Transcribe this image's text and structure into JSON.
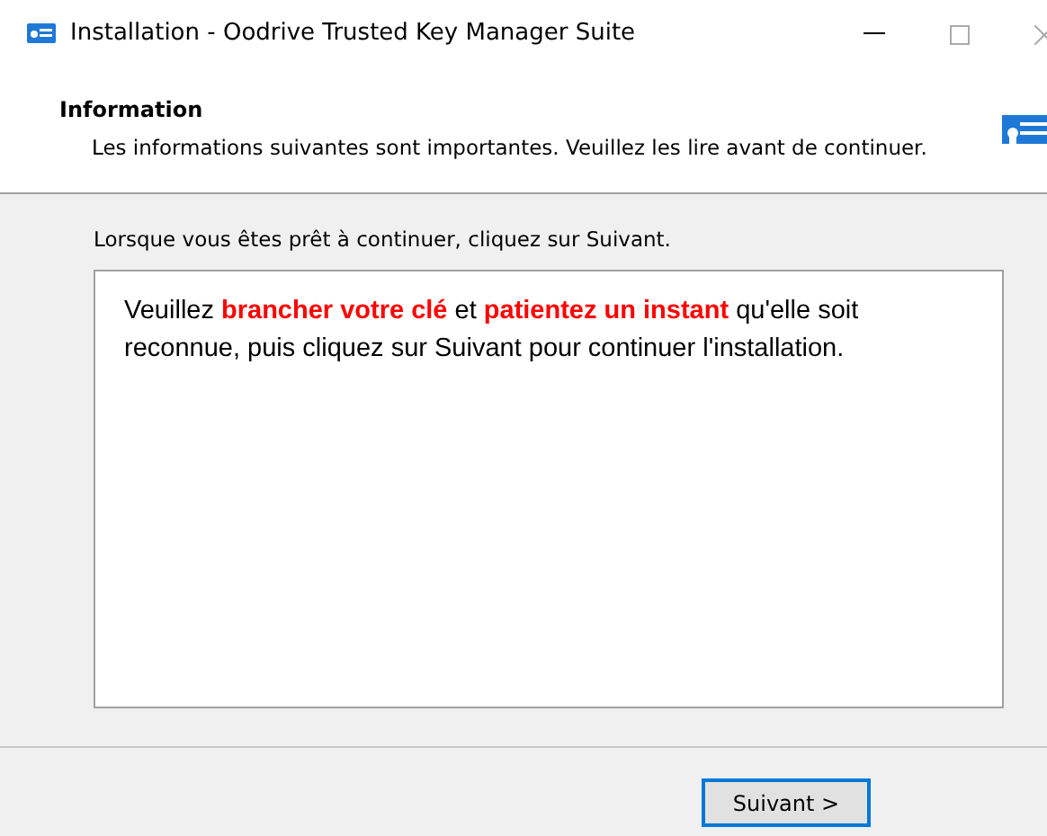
{
  "window": {
    "title": "Installation - Oodrive Trusted Key Manager Suite"
  },
  "header": {
    "title": "Information",
    "subtitle": "Les informations suivantes sont importantes. Veuillez les lire avant de continuer."
  },
  "body": {
    "instruction": "Lorsque vous êtes prêt à continuer, cliquez sur Suivant.",
    "memo": "Veuillez **brancher votre clé** et **patientez un instant** qu'elle soit reconnue, puis cliquez sur Suivant pour continuer l'installation."
  },
  "buttons": [
    {
      "label": "Suivant >",
      "focused": true
    }
  ]
}
